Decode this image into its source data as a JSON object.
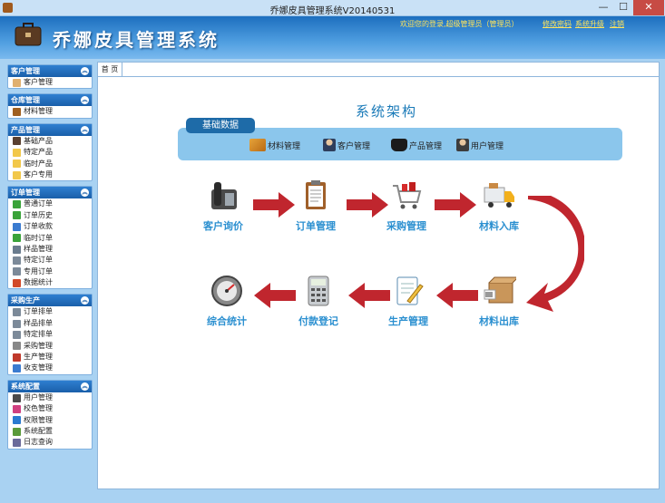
{
  "window": {
    "title": "乔娜皮具管理系统V20140531",
    "min": "—",
    "max": "☐",
    "close": "✕"
  },
  "header": {
    "app_name": "乔娜皮具管理系统",
    "welcome": "欢迎您的登录,超级管理员（管理员）",
    "links": [
      "修改密码",
      "系统升级",
      "注销"
    ]
  },
  "sidebar": {
    "sections": [
      {
        "title": "客户管理",
        "items": [
          {
            "label": "客户管理",
            "icon": "customer-icon"
          }
        ]
      },
      {
        "title": "仓库管理",
        "items": [
          {
            "label": "材料管理",
            "icon": "material-icon"
          }
        ]
      },
      {
        "title": "产品管理",
        "items": [
          {
            "label": "基础产品",
            "icon": "bag-icon"
          },
          {
            "label": "特定产品",
            "icon": "folder-icon"
          },
          {
            "label": "临时产品",
            "icon": "folder-icon"
          },
          {
            "label": "客户专用",
            "icon": "folder-icon"
          }
        ]
      },
      {
        "title": "订单管理",
        "items": [
          {
            "label": "普通订单",
            "icon": "order-icon"
          },
          {
            "label": "订单历史",
            "icon": "history-icon"
          },
          {
            "label": "订单收款",
            "icon": "money-icon"
          },
          {
            "label": "临时订单",
            "icon": "order-icon"
          },
          {
            "label": "样品管理",
            "icon": "sample-icon"
          },
          {
            "label": "特定订单",
            "icon": "doc-icon"
          },
          {
            "label": "专用订单",
            "icon": "doc-icon"
          },
          {
            "label": "数据统计",
            "icon": "stats-icon"
          }
        ]
      },
      {
        "title": "采购生产",
        "items": [
          {
            "label": "订单排单",
            "icon": "doc-icon"
          },
          {
            "label": "样品排单",
            "icon": "doc-icon"
          },
          {
            "label": "特定排单",
            "icon": "doc-icon"
          },
          {
            "label": "采购管理",
            "icon": "cart-icon"
          },
          {
            "label": "生产管理",
            "icon": "factory-icon"
          },
          {
            "label": "收支管理",
            "icon": "money-icon"
          }
        ]
      },
      {
        "title": "系统配置",
        "items": [
          {
            "label": "用户管理",
            "icon": "user-icon"
          },
          {
            "label": "校色管理",
            "icon": "color-icon"
          },
          {
            "label": "权限管理",
            "icon": "permission-icon"
          },
          {
            "label": "系统配置",
            "icon": "config-icon"
          },
          {
            "label": "日志查询",
            "icon": "log-icon"
          }
        ]
      }
    ]
  },
  "tabs": [
    {
      "label": "首 页"
    }
  ],
  "main": {
    "title": "系统架构",
    "base_tag": "基础数据",
    "base_items": [
      "材料管理",
      "客户管理",
      "产品管理",
      "用户管理"
    ],
    "flow_row1": [
      "客户询价",
      "订单管理",
      "采购管理",
      "材料入库"
    ],
    "flow_row2": [
      "材料出库",
      "生产管理",
      "付款登记",
      "综合统计"
    ]
  },
  "colors": {
    "accent": "#1a5fa9",
    "arrow": "#c0262e",
    "label": "#2a8fd0"
  }
}
